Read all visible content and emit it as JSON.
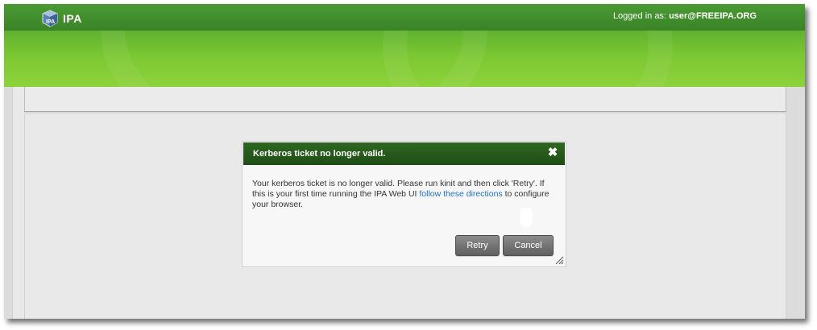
{
  "header": {
    "app_name": "IPA",
    "logged_in_label": "Logged in as:",
    "user": "user@FREEIPA.ORG"
  },
  "dialog": {
    "title": "Kerberos ticket no longer valid.",
    "message_part1": "Your kerberos ticket is no longer valid. Please run kinit and then click 'Retry'. If this is your first time running the IPA Web UI ",
    "link_text": "follow these directions",
    "message_part2": " to configure your browser.",
    "retry_label": "Retry",
    "cancel_label": "Cancel",
    "close_glyph": "✖"
  },
  "icons": {
    "logo": "ipa-logo-icon",
    "close": "close-icon",
    "resize": "resize-grip-icon"
  },
  "colors": {
    "header_dark": "#3a8327",
    "header_light": "#8dd23b",
    "dialog_title_bg": "#1e4d14",
    "link": "#1e6fc1",
    "button": "#6e6e6e"
  }
}
